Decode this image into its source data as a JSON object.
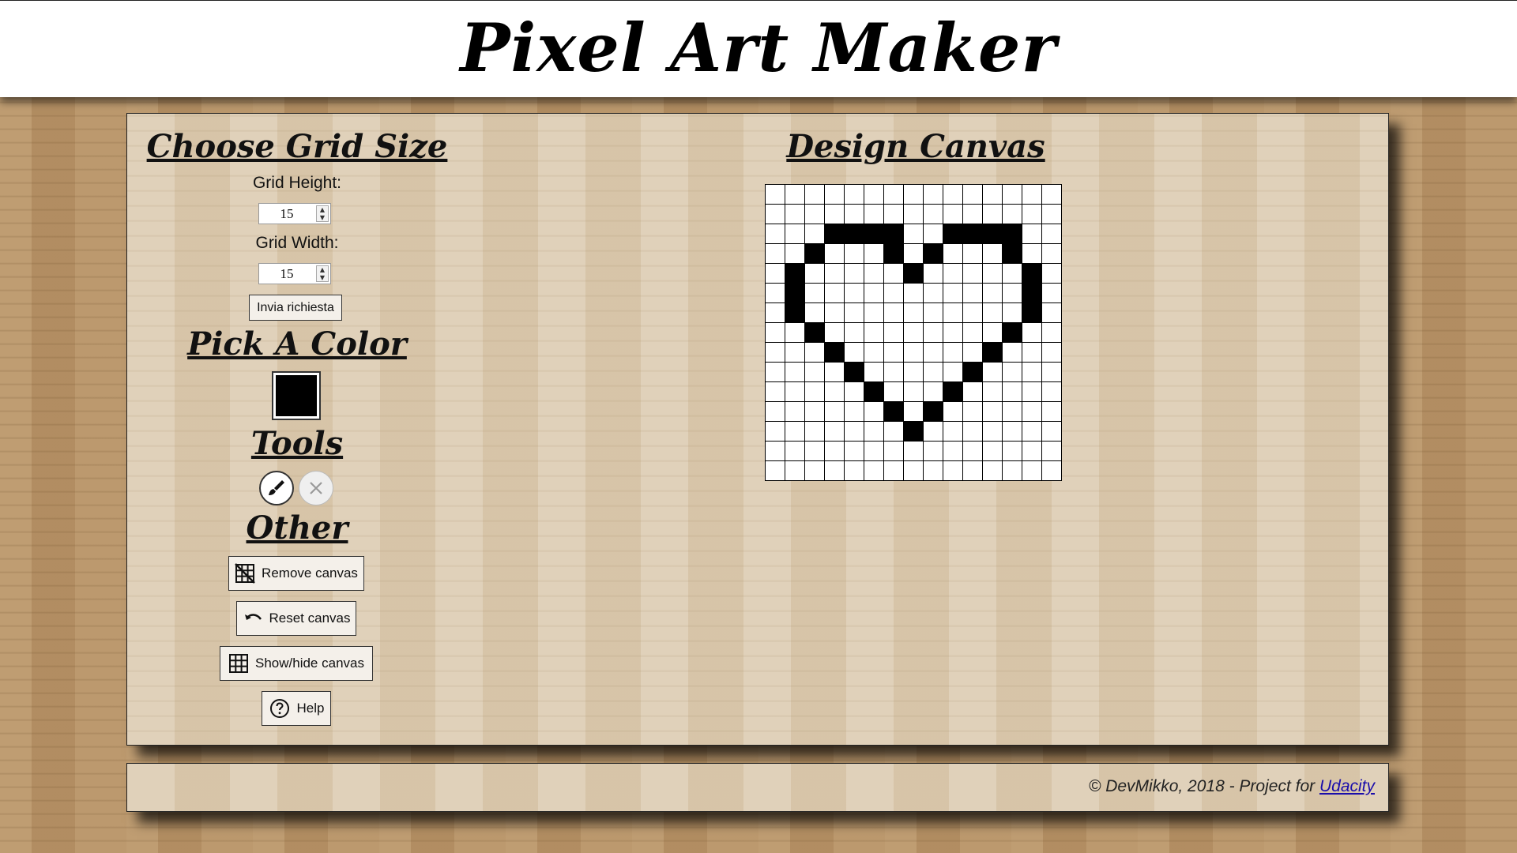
{
  "header": {
    "title": "Pixel Art Maker"
  },
  "sidebar": {
    "grid_section_title": "Choose Grid Size",
    "height_label": "Grid Height:",
    "height_value": "15",
    "width_label": "Grid Width:",
    "width_value": "15",
    "submit_label": "Invia richiesta",
    "color_section_title": "Pick A Color",
    "selected_color": "#000000",
    "tools_section_title": "Tools",
    "tools": [
      {
        "name": "brush",
        "icon": "brush-icon",
        "active": true
      },
      {
        "name": "eraser",
        "icon": "close-icon",
        "active": false
      }
    ],
    "other_section_title": "Other",
    "buttons": [
      {
        "label": "Remove canvas",
        "icon": "remove-grid-icon"
      },
      {
        "label": "Reset canvas",
        "icon": "undo-icon"
      },
      {
        "label": "Show/hide canvas",
        "icon": "grid-icon"
      },
      {
        "label": "Help",
        "icon": "help-circle-icon"
      }
    ]
  },
  "canvas": {
    "title": "Design Canvas",
    "rows": 15,
    "cols": 15,
    "filled_color": "#000000",
    "filled_cells": [
      [
        2,
        3
      ],
      [
        2,
        4
      ],
      [
        2,
        5
      ],
      [
        2,
        6
      ],
      [
        2,
        9
      ],
      [
        2,
        10
      ],
      [
        2,
        11
      ],
      [
        2,
        12
      ],
      [
        3,
        2
      ],
      [
        3,
        6
      ],
      [
        3,
        8
      ],
      [
        3,
        12
      ],
      [
        4,
        1
      ],
      [
        4,
        7
      ],
      [
        4,
        13
      ],
      [
        5,
        1
      ],
      [
        5,
        13
      ],
      [
        6,
        1
      ],
      [
        6,
        13
      ],
      [
        7,
        2
      ],
      [
        7,
        12
      ],
      [
        8,
        3
      ],
      [
        8,
        11
      ],
      [
        9,
        4
      ],
      [
        9,
        10
      ],
      [
        10,
        5
      ],
      [
        10,
        9
      ],
      [
        11,
        6
      ],
      [
        11,
        8
      ],
      [
        12,
        7
      ]
    ]
  },
  "footer": {
    "credit_text": "© DevMikko, 2018 - Project for ",
    "link_text": "Udacity"
  }
}
